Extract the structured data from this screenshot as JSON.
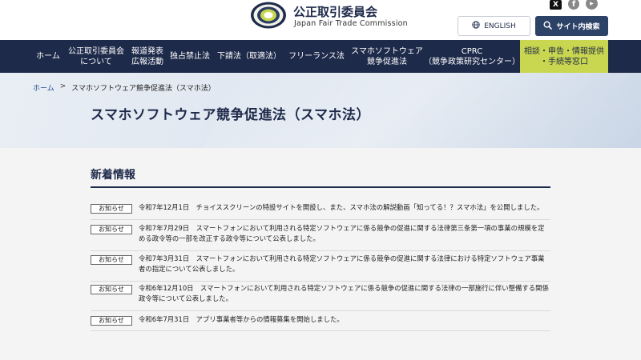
{
  "header": {
    "org_name": "公正取引委員会",
    "org_name_en": "Japan Fair Trade Commission",
    "lang_button": "ENGLISH",
    "search_button": "サイト内検索",
    "social": {
      "x": "X",
      "facebook": "f",
      "youtube": "▶"
    }
  },
  "nav": {
    "items": [
      {
        "line1": "ホーム",
        "line2": ""
      },
      {
        "line1": "公正取引委員会",
        "line2": "について"
      },
      {
        "line1": "報道発表",
        "line2": "広報活動"
      },
      {
        "line1": "独占禁止法",
        "line2": ""
      },
      {
        "line1": "下請法（取適法）",
        "line2": ""
      },
      {
        "line1": "フリーランス法",
        "line2": ""
      },
      {
        "line1": "スマホソフトウェア",
        "line2": "競争促進法"
      },
      {
        "line1": "CPRC",
        "line2": "（競争政策研究センター）"
      }
    ],
    "consult": {
      "line1": "相談・申告・情報提供",
      "line2": "・手続等窓口"
    }
  },
  "breadcrumb": {
    "home": "ホーム",
    "separator": ">",
    "current": "スマホソフトウェア競争促進法（スマホ法）"
  },
  "page_title": "スマホソフトウェア競争促進法（スマホ法）",
  "news": {
    "title": "新着情報",
    "badge": "お知らせ",
    "items": [
      {
        "text": "令和7年12月1日　チョイススクリーンの特設サイトを開設し、また、スマホ法の解説動画「知ってる！？スマホ法」を公開しました。"
      },
      {
        "text": "令和7年7月29日　スマートフォンにおいて利用される特定ソフトウェアに係る競争の促進に関する法律第三条第一項の事業の規模を定める政令等の一部を改正する政令等について公表しました。"
      },
      {
        "text": "令和7年3月31日　スマートフォンにおいて利用される特定ソフトウェアに係る競争の促進に関する法律における特定ソフトウェア事業者の指定について公表しました。"
      },
      {
        "text": "令和6年12月10日　スマートフォンにおいて利用される特定ソフトウェアに係る競争の促進に関する法律の一部施行に伴い整備する関係政令等について公表しました。"
      },
      {
        "text": "令和6年7月31日　アプリ事業者等からの情報募集を開始しました。"
      }
    ]
  },
  "colors": {
    "navy": "#1e2a4a",
    "accent_green": "#c9d64f",
    "search_button": "#2c4267"
  },
  "icons": {
    "lang": "globe-icon",
    "search": "search-icon",
    "logo": "jftc-logo-icon"
  }
}
